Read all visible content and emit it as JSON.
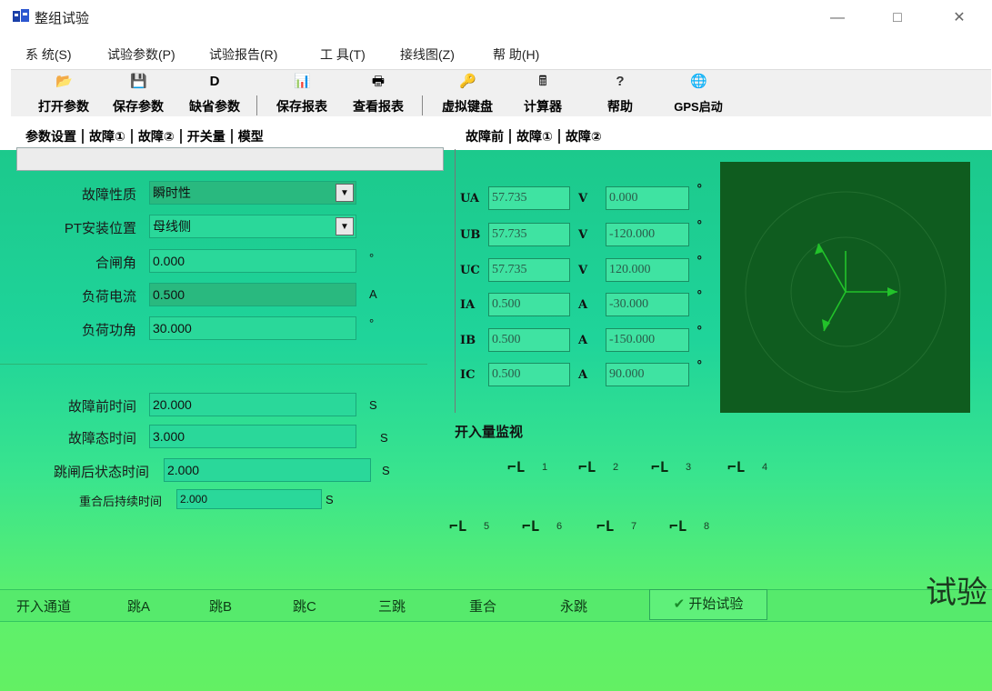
{
  "window": {
    "title": "整组试验",
    "controls": [
      "—",
      "□",
      "✕"
    ]
  },
  "menu": [
    "系 统(S)",
    "试验参数(P)",
    "试验报告(R)",
    "工 具(T)",
    "接线图(Z)",
    "帮 助(H)"
  ],
  "toolbar": [
    {
      "label": "打开参数",
      "icon": "folder-open-icon",
      "glyph": "📂"
    },
    {
      "label": "保存参数",
      "icon": "save-disk-icon",
      "glyph": "💾"
    },
    {
      "label": "缺省参数",
      "icon": "default-params-icon",
      "glyph": "D"
    },
    {
      "label": "保存报表",
      "icon": "excel-icon",
      "glyph": "📊"
    },
    {
      "label": "查看报表",
      "icon": "printer-icon",
      "glyph": "🖶"
    },
    {
      "label": "虚拟键盘",
      "icon": "key-icon",
      "glyph": "🔑"
    },
    {
      "label": "计算器",
      "icon": "calculator-icon",
      "glyph": "🖩"
    },
    {
      "label": "帮助",
      "icon": "help-icon",
      "glyph": "?"
    },
    {
      "label": "GPS启动",
      "icon": "globe-icon",
      "glyph": "🌐"
    }
  ],
  "left_tabs": [
    "参数设置",
    "故障①",
    "故障②",
    "开关量",
    "模型"
  ],
  "right_tabs": [
    "故障前",
    "故障①",
    "故障②"
  ],
  "params": {
    "fault_nature": {
      "label": "故障性质",
      "value": "瞬时性"
    },
    "pt_position": {
      "label": "PT安装位置",
      "value": "母线侧"
    },
    "close_angle": {
      "label": "合闸角",
      "value": "0.000",
      "unit": "°"
    },
    "load_current": {
      "label": "负荷电流",
      "value": "0.500",
      "unit": "A"
    },
    "load_angle": {
      "label": "负荷功角",
      "value": "30.000",
      "unit": "°"
    },
    "prefault_time": {
      "label": "故障前时间",
      "value": "20.000",
      "unit": "S"
    },
    "fault_time": {
      "label": "故障态时间",
      "value": "3.000",
      "unit": "S"
    },
    "post_trip_time": {
      "label": "跳闸后状态时间",
      "value": "2.000",
      "unit": "S"
    },
    "extra_time": {
      "label": "重合后持续时间",
      "value": "2.000",
      "unit": "S"
    }
  },
  "measures": [
    {
      "name": "UA",
      "mag": "57.735",
      "mag_unit": "V",
      "ang": "0.000"
    },
    {
      "name": "UB",
      "mag": "57.735",
      "mag_unit": "V",
      "ang": "-120.000"
    },
    {
      "name": "UC",
      "mag": "57.735",
      "mag_unit": "V",
      "ang": "120.000"
    },
    {
      "name": "IA",
      "mag": "0.500",
      "mag_unit": "A",
      "ang": "-30.000"
    },
    {
      "name": "IB",
      "mag": "0.500",
      "mag_unit": "A",
      "ang": "-150.000"
    },
    {
      "name": "IC",
      "mag": "0.500",
      "mag_unit": "A",
      "ang": "90.000"
    }
  ],
  "angle_unit": "°",
  "switch_monitor": {
    "title": "开入量监视",
    "channels": [
      "1",
      "2",
      "3",
      "4",
      "5",
      "6",
      "7",
      "8"
    ]
  },
  "channels": [
    "开入通道",
    "跳A",
    "跳B",
    "跳C",
    "三跳",
    "重合",
    "永跳"
  ],
  "start_button": "开始试验",
  "side_label": "试验结果"
}
